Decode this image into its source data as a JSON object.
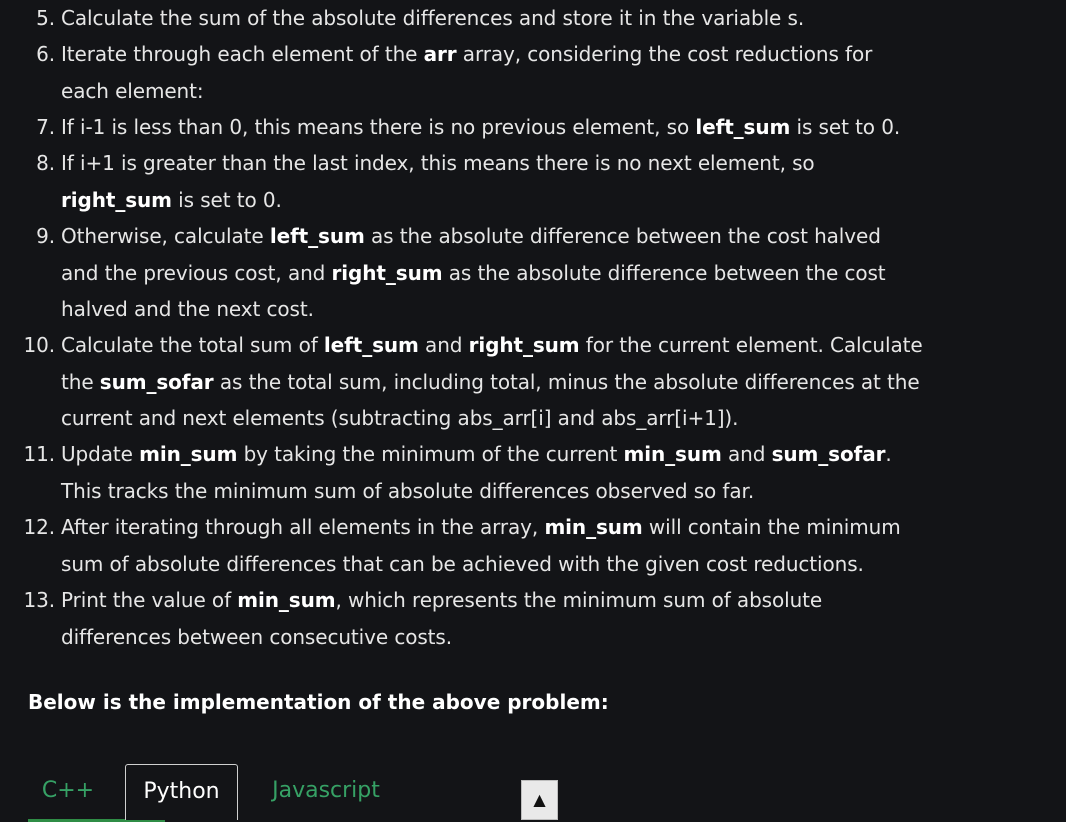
{
  "steps": [
    {
      "num": "5.",
      "lines": [
        "Calculate the sum of the absolute differences and store it in the variable s."
      ]
    },
    {
      "num": "6.",
      "lines": [
        "Iterate through each element of the **arr** array, considering the cost reductions for",
        "each element:"
      ]
    },
    {
      "num": "7.",
      "lines": [
        "If i-1 is less than 0, this means there is no previous element, so **left_sum** is set to 0."
      ]
    },
    {
      "num": "8.",
      "lines": [
        "If i+1 is greater than the last index, this means there is no next element, so",
        "**right_sum** is set to 0."
      ]
    },
    {
      "num": "9.",
      "lines": [
        "Otherwise, calculate **left_sum** as the absolute difference between the cost halved",
        "and the previous cost, and **right_sum** as the absolute difference between the cost",
        "halved and the next cost."
      ]
    },
    {
      "num": "10.",
      "lines": [
        "Calculate the total sum of **left_sum** and **right_sum** for the current element. Calculate",
        "the **sum_sofar** as the total sum, including total, minus the absolute differences at the",
        "current and next elements (subtracting abs_arr[i] and abs_arr[i+1])."
      ]
    },
    {
      "num": "11.",
      "lines": [
        "Update **min_sum** by taking the minimum of the current **min_sum** and **sum_sofar**.",
        "This tracks the minimum sum of absolute differences observed so far."
      ]
    },
    {
      "num": "12.",
      "lines": [
        "After iterating through all elements in the array, **min_sum** will contain the minimum",
        "sum of absolute differences that can be achieved with the given cost reductions."
      ]
    },
    {
      "num": "13.",
      "lines": [
        "Print the value of **min_sum**, which represents the minimum sum of absolute",
        "differences between consecutive costs."
      ]
    }
  ],
  "implementation_heading": "Below is the implementation of the above problem:",
  "tabs": [
    {
      "label": "C++",
      "active": false
    },
    {
      "label": "Python",
      "active": true
    },
    {
      "label": "Javascript",
      "active": false
    }
  ],
  "scroll_button": {
    "icon": "triangle-up-icon",
    "glyph": "▲"
  },
  "colors": {
    "background": "#131417",
    "text": "#e6e6e6",
    "accent_green": "#2f8d46",
    "tab_text_green": "#36a165"
  }
}
